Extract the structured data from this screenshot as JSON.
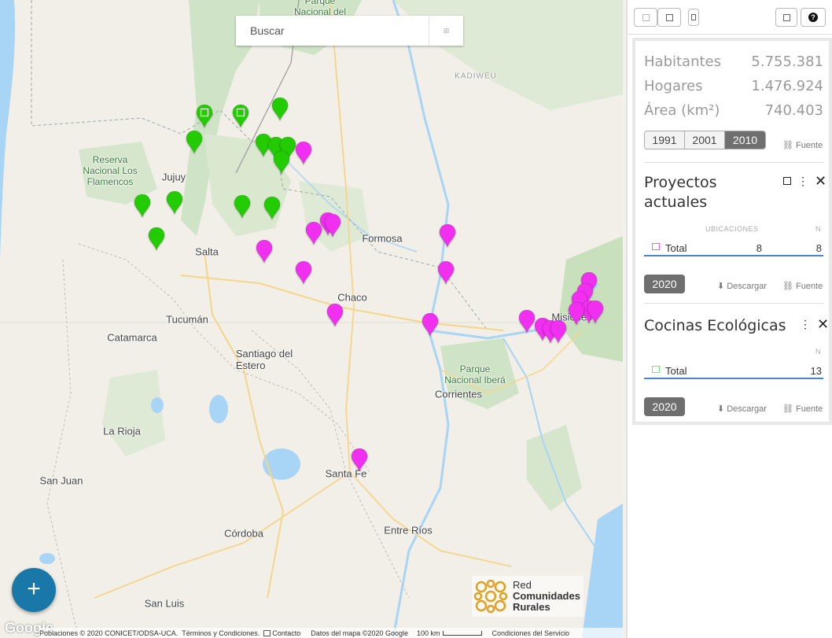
{
  "map": {
    "search_placeholder": "Buscar",
    "search_button_label": "⊞",
    "fab_label": "+",
    "places": [
      {
        "id": "parque-nacional-del",
        "label": "Parque\nNacional del",
        "style": "green"
      },
      {
        "id": "kadiweu",
        "label": "KADIWÉU",
        "style": "dim"
      },
      {
        "id": "reserva-flamencos",
        "label": "Reserva\nNacional Los\nFlamencos",
        "style": "green"
      },
      {
        "id": "jujuy",
        "label": "Jujuy",
        "style": "normal"
      },
      {
        "id": "salta",
        "label": "Salta",
        "style": "normal"
      },
      {
        "id": "formosa",
        "label": "Formosa",
        "style": "normal"
      },
      {
        "id": "chaco",
        "label": "Chaco",
        "style": "normal"
      },
      {
        "id": "tucuman",
        "label": "Tucumán",
        "style": "normal"
      },
      {
        "id": "catamarca",
        "label": "Catamarca",
        "style": "normal"
      },
      {
        "id": "santiago",
        "label": "Santiago del\nEstero",
        "style": "normal"
      },
      {
        "id": "misiones",
        "label": "Misiones",
        "style": "normal"
      },
      {
        "id": "ibera",
        "label": "Parque\nNacional Iberá",
        "style": "green"
      },
      {
        "id": "corrientes",
        "label": "Corrientes",
        "style": "normal"
      },
      {
        "id": "la-rioja",
        "label": "La Rioja",
        "style": "normal"
      },
      {
        "id": "san-juan",
        "label": "San Juan",
        "style": "normal"
      },
      {
        "id": "santa-fe",
        "label": "Santa Fe",
        "style": "normal"
      },
      {
        "id": "cordoba",
        "label": "Córdoba",
        "style": "normal"
      },
      {
        "id": "entre-rios",
        "label": "Entre Ríos",
        "style": "normal"
      },
      {
        "id": "san-luis",
        "label": "San Luis",
        "style": "normal"
      }
    ],
    "logo": {
      "line1": "Red",
      "line2": "Comunidades",
      "line3": "Rurales"
    },
    "google_label": "Google",
    "footer": {
      "poblaciones": "Poblaciones © 2020 CONICET/ODSA-UCA.",
      "terminos": "Términos y Condiciones.",
      "contacto": "Contacto",
      "datos": "Datos del mapa ©2020 Google",
      "scale": "100 km",
      "condiciones": "Condiciones del Servicio"
    },
    "colors": {
      "green_pin": "#22cc00",
      "magenta_pin": "#f02ff0"
    }
  },
  "sidebar": {
    "stats": [
      {
        "label": "Habitantes",
        "value": "5.755.381"
      },
      {
        "label": "Hogares",
        "value": "1.476.924"
      },
      {
        "label": "Área (km²)",
        "value": "740.403"
      }
    ],
    "years": [
      "1991",
      "2001",
      "2010"
    ],
    "active_year": "2010",
    "fuente_label": "Fuente",
    "descargar_label": "Descargar",
    "sections": [
      {
        "title": "Proyectos actuales",
        "col_ubicaciones": "UBICACIONES",
        "col_n": "N",
        "total_label": "Total",
        "total_ubicaciones": "8",
        "total_n": "8",
        "year": "2020",
        "color": "#f060f0"
      },
      {
        "title": "Cocinas Ecológicas",
        "col_n": "N",
        "total_label": "Total",
        "total_n": "13",
        "year": "2020",
        "color": "#80e080"
      }
    ]
  }
}
